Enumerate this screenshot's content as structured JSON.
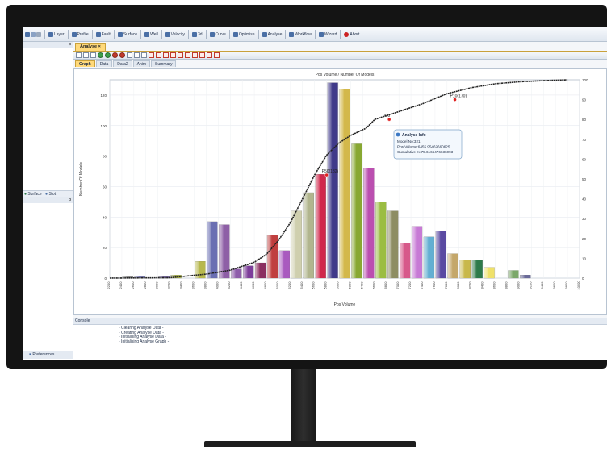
{
  "toolbar": {
    "items": [
      "Layer",
      "Profile",
      "Fault",
      "Surface",
      "Well",
      "Velocity",
      "3d",
      "Curve",
      "Optimise",
      "Analyse",
      "Workflow",
      "Wizard",
      "Abort"
    ]
  },
  "left_panel": {
    "pin_top": "p",
    "mid_items": [
      "Surface",
      "Slot"
    ],
    "pin_mid": "p",
    "footer_label": "Preferences"
  },
  "document_tab": "Analyse",
  "sub_tabs": [
    "Graph",
    "Data",
    "Data2",
    "Anim",
    "Summary"
  ],
  "chart_data": {
    "type": "bar",
    "title": "Pos Volume / Number Of Models",
    "xlabel": "Pos Volume",
    "ylabel": "Number Of Models",
    "ylim": [
      0,
      130
    ],
    "y2lim": [
      0,
      100
    ],
    "yticks": [
      0,
      20,
      40,
      60,
      80,
      100,
      120
    ],
    "y2ticks": [
      0,
      10,
      20,
      30,
      40,
      50,
      60,
      70,
      80,
      90,
      100
    ],
    "categories": [
      "2200",
      "2400",
      "2600",
      "2800",
      "3000",
      "3200",
      "3400",
      "3600",
      "3800",
      "4000",
      "4200",
      "4400",
      "4600",
      "4800",
      "5000",
      "5200",
      "5400",
      "5600",
      "5800",
      "6000",
      "6200",
      "6400",
      "6600",
      "6800",
      "7000",
      "7200",
      "7400",
      "7600",
      "7800",
      "8000",
      "8200",
      "8400",
      "8600",
      "8800",
      "9000",
      "9200",
      "9400",
      "9600",
      "9800",
      "10000"
    ],
    "bin_start": 2200,
    "bin_width": 200,
    "values": [
      0,
      1,
      1,
      0,
      1,
      2,
      0,
      11,
      37,
      35,
      6,
      8,
      10,
      28,
      18,
      44,
      56,
      68,
      128,
      124,
      88,
      72,
      50,
      44,
      23,
      34,
      27,
      31,
      16,
      12,
      12,
      7,
      0,
      5,
      2,
      0,
      0,
      0,
      0
    ],
    "bar_colors": [
      "#8d9e6a",
      "#8f8f8f",
      "#7a7bb0",
      "#8c7aa5",
      "#7e6fa8",
      "#a8b04a",
      "#a3aa3c",
      "#b7b84e",
      "#6a6fb2",
      "#8e5fa6",
      "#8e5eaa",
      "#7d3e9a",
      "#8b2f60",
      "#c03f3f",
      "#a95abf",
      "#cfcfae",
      "#b1b58e",
      "#d0284c",
      "#403a8a",
      "#d3b84a",
      "#88a832",
      "#bb4fb0",
      "#9bbd42",
      "#8d8d63",
      "#d7598a",
      "#c77ad5",
      "#63afd2",
      "#5a4aa2",
      "#c4a76a",
      "#c8b84a",
      "#2d7a4a",
      "#efe16a",
      "#3c8a5a",
      "#7ba86a",
      "#6a6a9a",
      "#6a6a6a",
      "#6a6a6a",
      "#6a6a6a",
      "#6a6a6a"
    ],
    "cumulative": {
      "name": "Cumulative %",
      "x": [
        2200,
        3200,
        3400,
        3800,
        4200,
        4600,
        4800,
        5000,
        5200,
        5400,
        5600,
        5800,
        6000,
        6200,
        6455.95,
        6600,
        7000,
        7400,
        7800,
        8200,
        8600,
        9000,
        9400,
        9800
      ],
      "y": [
        0,
        0.2,
        0.8,
        2,
        4,
        8,
        12,
        19,
        28,
        40,
        52,
        62,
        68,
        72,
        75.6,
        80,
        84,
        88,
        93,
        96,
        98,
        99,
        99.6,
        100
      ]
    },
    "annotations": [
      {
        "label": "P10(170)",
        "x": 7930,
        "y": 90
      },
      {
        "label": "M0",
        "x": 6840,
        "y": 80
      },
      {
        "label": "P50(132)",
        "x": 5800,
        "y": 52
      }
    ],
    "tooltip": {
      "title": "Analyse Info",
      "lines": [
        "Model No:321",
        "Pos Volume:6455.95462660625",
        "Cumulative %:75.6166476636093"
      ]
    }
  },
  "console": {
    "title": "Console",
    "lines": [
      "- Clearing Analyse Data -",
      "- Creating Analyse Data -",
      "- Initialising Analyse Data -",
      "- Initialising Analyse Graph -"
    ]
  }
}
